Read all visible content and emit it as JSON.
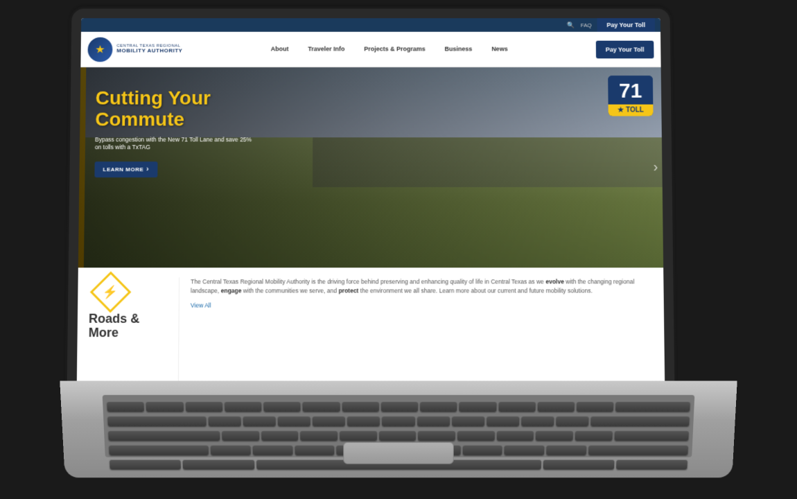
{
  "topbar": {
    "items": [
      "FAQ",
      "Pay Your Toll"
    ]
  },
  "nav": {
    "logo": {
      "small_text": "Central Texas Regional",
      "big_text": "Mobility Authority",
      "star": "★"
    },
    "links": [
      {
        "label": "About"
      },
      {
        "label": "Traveler Info"
      },
      {
        "label": "Projects & Programs"
      },
      {
        "label": "Business"
      },
      {
        "label": "News"
      }
    ],
    "cta": "Pay Your Toll"
  },
  "hero": {
    "title": "Cutting Your Commute",
    "subtitle": "Bypass congestion with the New 71 Toll Lane and save 25% on tolls with a TxTAG",
    "btn_label": "LEARN MORE",
    "btn_arrow": "›",
    "toll_number": "71",
    "toll_label": "TOLL",
    "next_arrow": "›"
  },
  "lower": {
    "roads": {
      "icon": "⚡",
      "title": "Roads &",
      "title2": "More"
    },
    "description": {
      "text1": "The Central Texas Regional Mobility Authority is the driving force behind preserving and enhancing quality of life in Central Texas as we ",
      "bold1": "evolve",
      "text2": " with the changing regional landscape, ",
      "bold2": "engage",
      "text3": " with the communities we serve, and ",
      "bold3": "protect",
      "text4": " the environment we all share. Learn more about our current and future mobility solutions.",
      "view_all": "View All"
    }
  }
}
